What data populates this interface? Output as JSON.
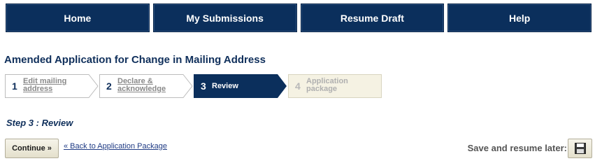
{
  "nav": {
    "items": [
      {
        "label": "Home"
      },
      {
        "label": "My Submissions"
      },
      {
        "label": "Resume Draft"
      },
      {
        "label": "Help"
      }
    ]
  },
  "page": {
    "title": "Amended Application for Change in Mailing Address"
  },
  "steps": [
    {
      "number": "1",
      "label": "Edit mailing address",
      "state": "completed"
    },
    {
      "number": "2",
      "label": "Declare & acknowledge",
      "state": "completed"
    },
    {
      "number": "3",
      "label": "Review",
      "state": "active"
    },
    {
      "number": "4",
      "label": "Application package",
      "state": "upcoming"
    }
  ],
  "current_step": {
    "heading": "Step 3 : Review"
  },
  "actions": {
    "continue_label": "Continue »",
    "back_link": "« Back to Application Package",
    "save_label": "Save and resume later:",
    "save_icon": "floppy-disk-icon"
  },
  "colors": {
    "nav_bg": "#0b2f5c",
    "active_step_bg": "#0b2f5c",
    "future_step_bg": "#f5f2e3",
    "title_color": "#0f2f5b"
  }
}
